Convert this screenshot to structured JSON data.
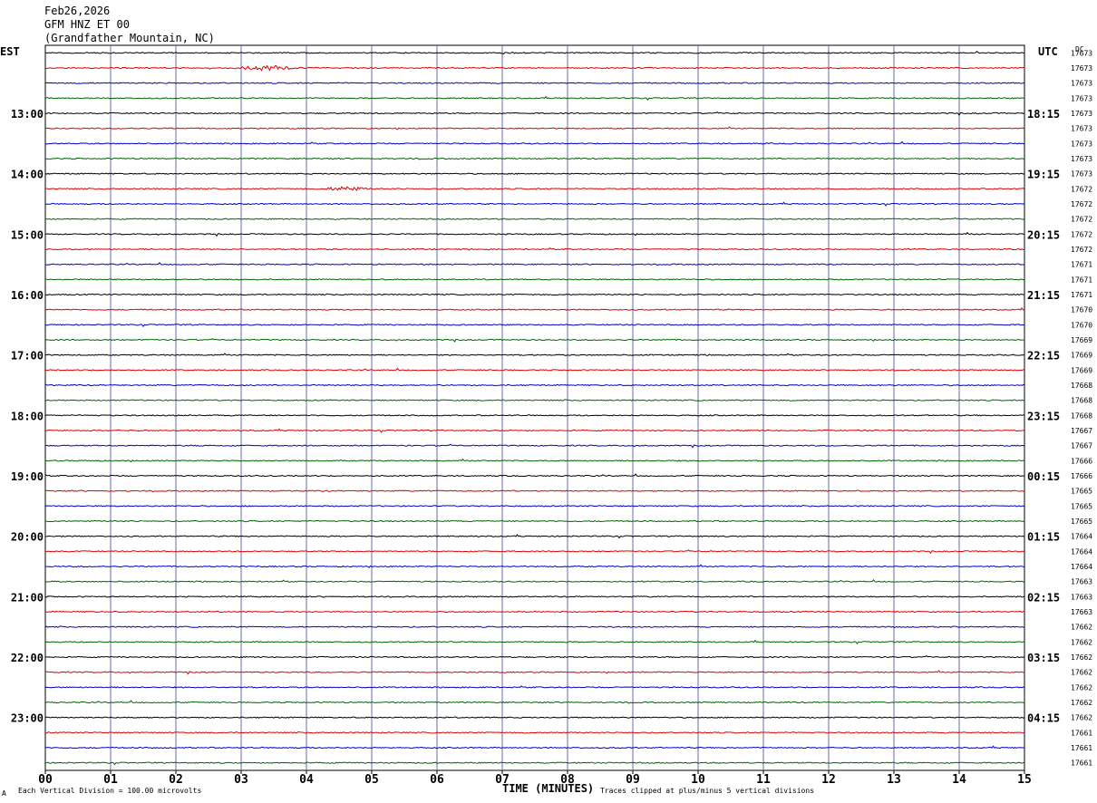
{
  "header": {
    "date": "Feb26,2026",
    "station": "GFM HNZ ET 00",
    "location": "(Grandfather Mountain, NC)"
  },
  "left_tz": "EST",
  "right_tz": "UTC",
  "right_unit": "DC",
  "footer": {
    "scale": "Each Vertical Division =  100.00 microvolts",
    "clip": "Traces clipped at plus/minus 5 vertical divisions",
    "corner_mark": "A"
  },
  "colors": {
    "trace_cycle": [
      "#000000",
      "#e00000",
      "#0000cc",
      "#006400"
    ],
    "grid_vertical": "#6a6aa8",
    "frame": "#000000"
  },
  "chart_data": {
    "type": "line",
    "subtype": "helicorder",
    "xlabel": "TIME (MINUTES)",
    "x_ticks": [
      "00",
      "01",
      "02",
      "03",
      "04",
      "05",
      "06",
      "07",
      "08",
      "09",
      "10",
      "11",
      "12",
      "13",
      "14",
      "15"
    ],
    "xlim": [
      0,
      15
    ],
    "rows": 48,
    "minutes_per_row": 15,
    "left_hour_labels": [
      "13:00",
      "14:00",
      "15:00",
      "16:00",
      "17:00",
      "18:00",
      "19:00",
      "20:00",
      "21:00",
      "22:00",
      "23:00"
    ],
    "right_hour_labels": [
      "18:15",
      "19:15",
      "20:15",
      "21:15",
      "22:15",
      "23:15",
      "00:15",
      "01:15",
      "02:15",
      "03:15",
      "04:15"
    ],
    "first_labeled_row": 4,
    "row_dc_counts": [
      "17673",
      "17673",
      "17673",
      "17673",
      "17673",
      "17673",
      "17673",
      "17673",
      "17673",
      "17672",
      "17672",
      "17672",
      "17672",
      "17672",
      "17671",
      "17671",
      "17671",
      "17670",
      "17670",
      "17669",
      "17669",
      "17669",
      "17668",
      "17668",
      "17668",
      "17667",
      "17667",
      "17666",
      "17666",
      "17665",
      "17665",
      "17665",
      "17664",
      "17664",
      "17664",
      "17663",
      "17663",
      "17663",
      "17662",
      "17662",
      "17662",
      "17662",
      "17662",
      "17662",
      "17662",
      "17661",
      "17661",
      "17661"
    ],
    "events": [
      {
        "row": 1,
        "minute_start": 2.85,
        "minute_end": 3.95,
        "amplitude": "small"
      },
      {
        "row": 9,
        "minute_start": 4.2,
        "minute_end": 5.0,
        "amplitude": "small"
      }
    ],
    "trace_note": "noise-level traces, no clipping visible"
  }
}
